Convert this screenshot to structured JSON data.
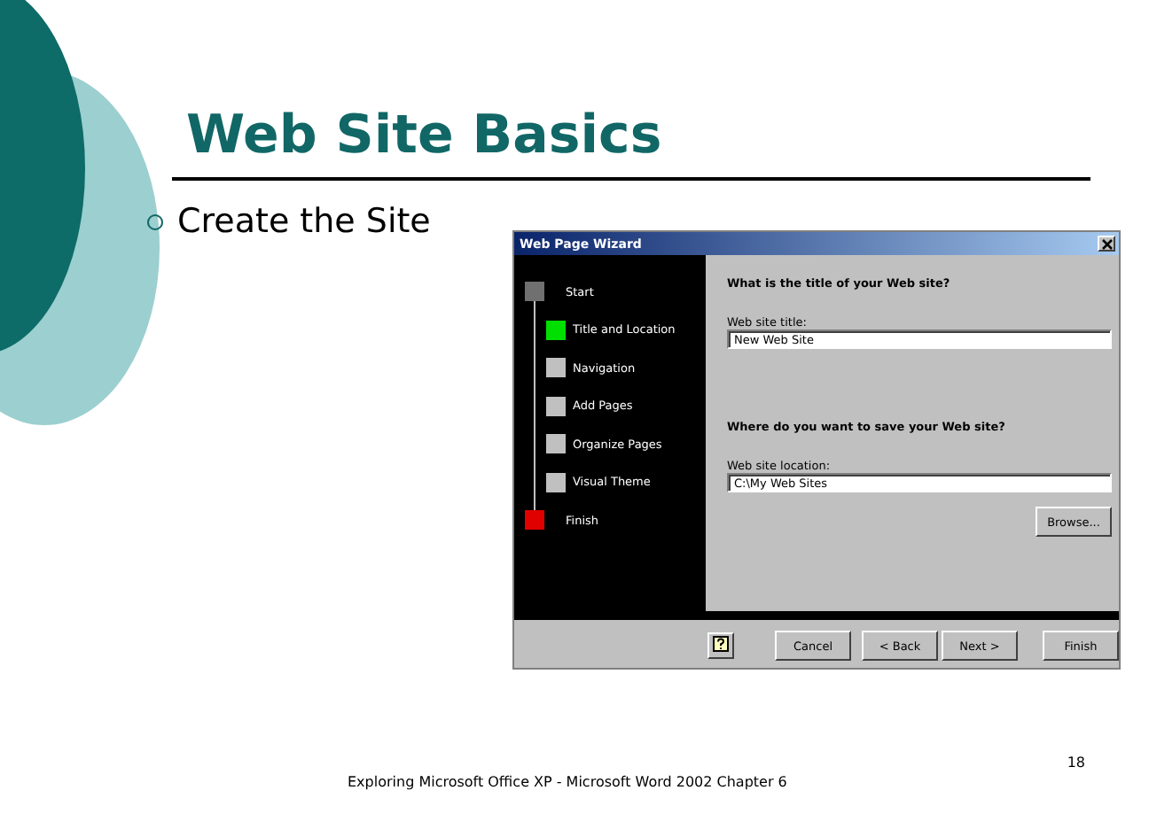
{
  "slide": {
    "title": "Web Site Basics",
    "bullets": [
      "Create the Site"
    ],
    "footer": "Exploring Microsoft Office XP - Microsoft Word 2002 Chapter 6",
    "page_number": "18"
  },
  "wizard": {
    "title": "Web Page Wizard",
    "steps": [
      {
        "label": "Start",
        "kind": "end",
        "color": "#707070"
      },
      {
        "label": "Title and Location",
        "kind": "step",
        "color": "#00e000"
      },
      {
        "label": "Navigation",
        "kind": "step",
        "color": "#c0c0c0"
      },
      {
        "label": "Add Pages",
        "kind": "step",
        "color": "#c0c0c0"
      },
      {
        "label": "Organize Pages",
        "kind": "step",
        "color": "#c0c0c0"
      },
      {
        "label": "Visual Theme",
        "kind": "step",
        "color": "#c0c0c0"
      },
      {
        "label": "Finish",
        "kind": "end",
        "color": "#e00000"
      }
    ],
    "sections": [
      {
        "heading": "What is the title of your Web site?",
        "label": "Web site title:",
        "value": "New Web Site"
      },
      {
        "heading": "Where do you want to save your Web site?",
        "label": "Web site location:",
        "value": "C:\\My Web Sites",
        "button": "Browse..."
      }
    ],
    "buttons": [
      "Cancel",
      "< Back",
      "Next >",
      "Finish"
    ]
  }
}
